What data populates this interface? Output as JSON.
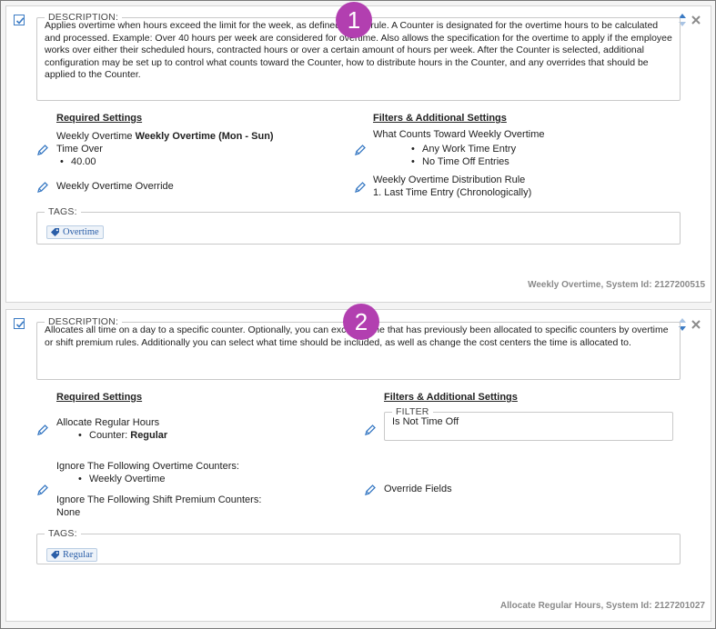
{
  "rules": [
    {
      "callout": "1",
      "description_legend": "DESCRIPTION:",
      "description": "Applies overtime when hours exceed the limit for the week, as defined in this rule. A Counter is designated for the overtime hours to be calculated and processed. Example: Over 40 hours per week are considered for overtime. Also allows the specification for the overtime to apply if the employee works over either their scheduled hours, contracted hours or over a certain amount of hours per week. After the Counter is selected, additional configuration may be set up to control what counts toward the Counter, how to distribute hours in the Counter, and any overrides that should be applied to the Counter.",
      "required_title": "Required Settings",
      "filters_title": "Filters & Additional Settings",
      "setting_name_a": "Weekly Overtime ",
      "setting_name_b": "Weekly Overtime  (Mon - Sun)",
      "time_over_label": "Time Over",
      "time_over_value": "40.00",
      "override_label": "Weekly Overtime Override",
      "counts_toward_title": "What Counts Toward Weekly Overtime",
      "counts_toward_items": [
        "Any Work Time Entry",
        "No Time Off Entries"
      ],
      "distribution_title": "Weekly Overtime Distribution Rule",
      "distribution_value": "1.  Last Time Entry (Chronologically)",
      "tags_legend": "TAGS:",
      "tag": "Overtime",
      "footer": "Weekly Overtime, System Id: 2127200515"
    },
    {
      "callout": "2",
      "description_legend": "DESCRIPTION:",
      "description": "Allocates all time on a day to a specific counter. Optionally, you can exclude time that has previously been allocated to specific counters by overtime or shift premium rules. Additionally you can select what time should be included, as well as change the cost centers the time is allocated to.",
      "required_title": "Required Settings",
      "filters_title": "Filters & Additional Settings",
      "allocate_label": "Allocate Regular Hours",
      "counter_label": "Counter: ",
      "counter_value": "Regular",
      "filter_legend": "FILTER",
      "filter_value": "Is Not Time Off",
      "ignore_ot_label": "Ignore The Following Overtime Counters:",
      "ignore_ot_item": "Weekly Overtime",
      "ignore_sp_label": "Ignore The Following Shift Premium Counters:",
      "ignore_sp_value": "None",
      "override_fields_label": "Override Fields",
      "tags_legend": "TAGS:",
      "tag": "Regular",
      "footer": "Allocate Regular Hours, System Id: 2127201027"
    }
  ],
  "colors": {
    "accent": "#3b7bc4",
    "callout": "#b23fb0",
    "footer_text": "#8a8a8a"
  },
  "icons": [
    "checkbox-checked-icon",
    "sort-icon",
    "close-icon",
    "pencil-icon",
    "tag-icon"
  ]
}
